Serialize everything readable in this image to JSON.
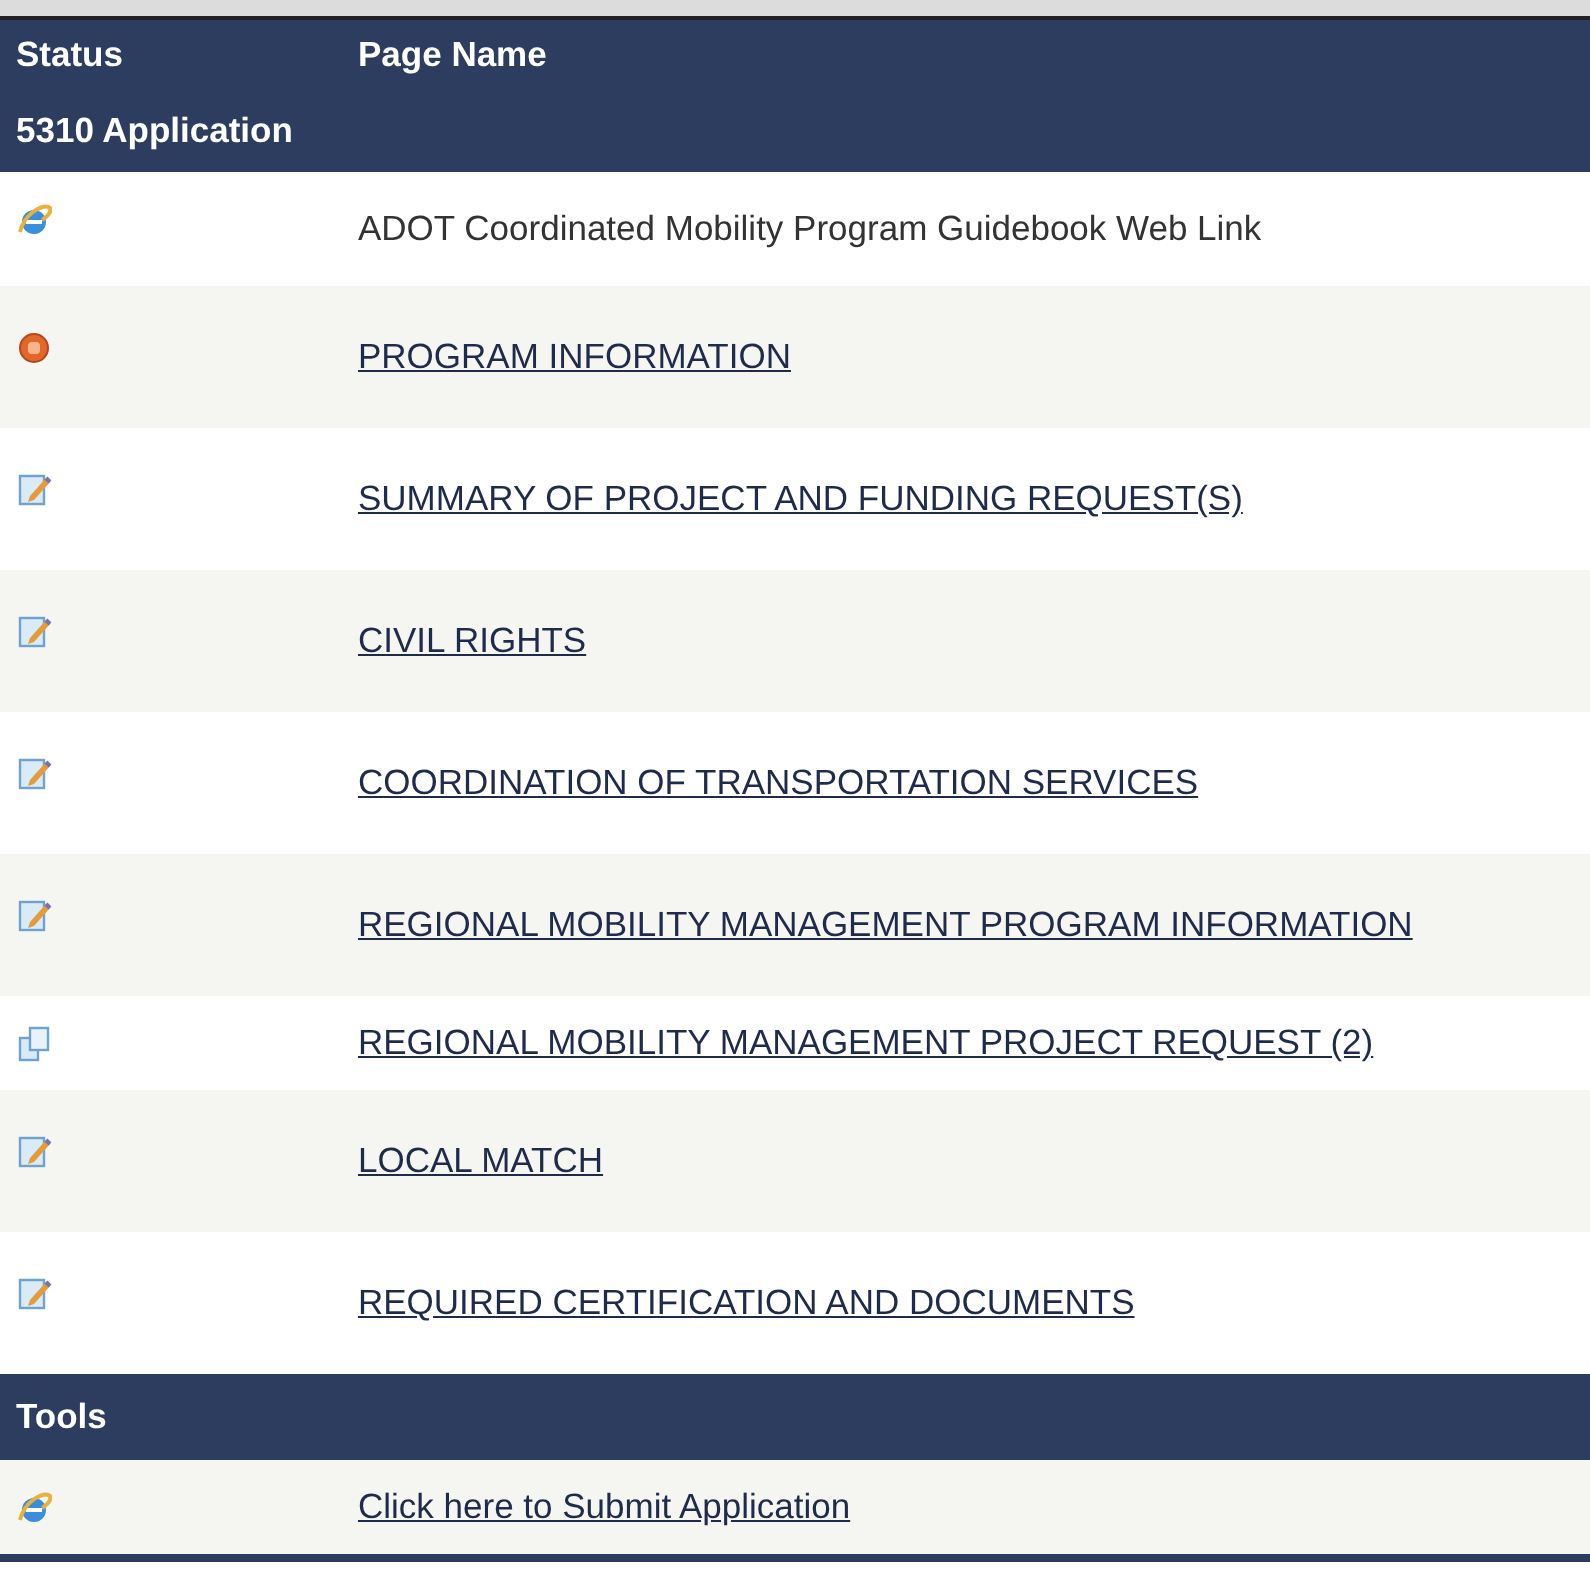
{
  "table": {
    "columns": [
      "Status",
      "Page Name"
    ],
    "sections": [
      {
        "title": "5310 Application",
        "rows": [
          {
            "kind": "web",
            "link": false,
            "text": "ADOT Coordinated Mobility Program Guidebook Web Link"
          },
          {
            "kind": "stop",
            "link": true,
            "text": "PROGRAM INFORMATION"
          },
          {
            "kind": "edit",
            "link": true,
            "text": "SUMMARY OF PROJECT AND FUNDING REQUEST(S)"
          },
          {
            "kind": "edit",
            "link": true,
            "text": "CIVIL RIGHTS"
          },
          {
            "kind": "edit",
            "link": true,
            "text": "COORDINATION OF TRANSPORTATION SERVICES"
          },
          {
            "kind": "edit",
            "link": true,
            "text": "REGIONAL MOBILITY MANAGEMENT PROGRAM INFORMATION"
          },
          {
            "kind": "copy",
            "link": true,
            "text": "REGIONAL MOBILITY MANAGEMENT PROJECT REQUEST (2)"
          },
          {
            "kind": "edit",
            "link": true,
            "text": "LOCAL MATCH"
          },
          {
            "kind": "edit",
            "link": true,
            "text": "REQUIRED CERTIFICATION AND DOCUMENTS"
          }
        ]
      },
      {
        "title": "Tools",
        "rows": [
          {
            "kind": "web",
            "link": true,
            "text": "Click here to Submit Application"
          }
        ]
      }
    ]
  }
}
